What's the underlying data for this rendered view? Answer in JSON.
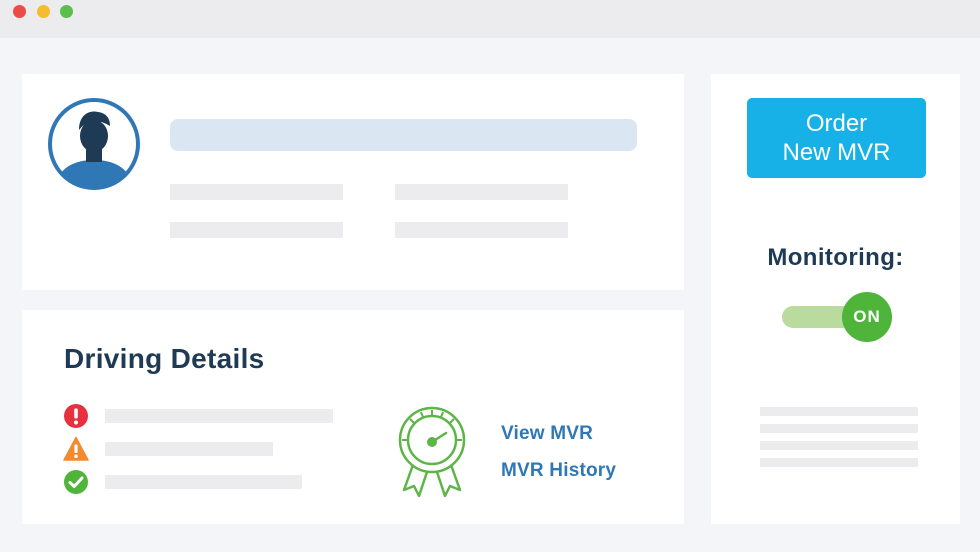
{
  "window": {
    "controls": [
      "close",
      "minimize",
      "maximize"
    ]
  },
  "profile": {
    "avatar_icon": "user-avatar-icon"
  },
  "details": {
    "title": "Driving Details",
    "status_icons": [
      "error-icon",
      "warning-icon",
      "success-icon"
    ],
    "badge_icon": "award-ribbon-gauge-icon",
    "links": {
      "view_mvr": "View MVR",
      "mvr_history": "MVR History"
    }
  },
  "side": {
    "order_button": {
      "line1": "Order",
      "line2": "New MVR"
    },
    "monitoring_label": "Monitoring:",
    "toggle_state": "ON"
  },
  "colors": {
    "accent_blue": "#17b1e8",
    "title_navy": "#1f3a55",
    "link_blue": "#2f78b5",
    "toggle_green": "#4eb53a",
    "error_red": "#e8313f",
    "warning_orange": "#f28a30",
    "success_green": "#4eb53a"
  }
}
